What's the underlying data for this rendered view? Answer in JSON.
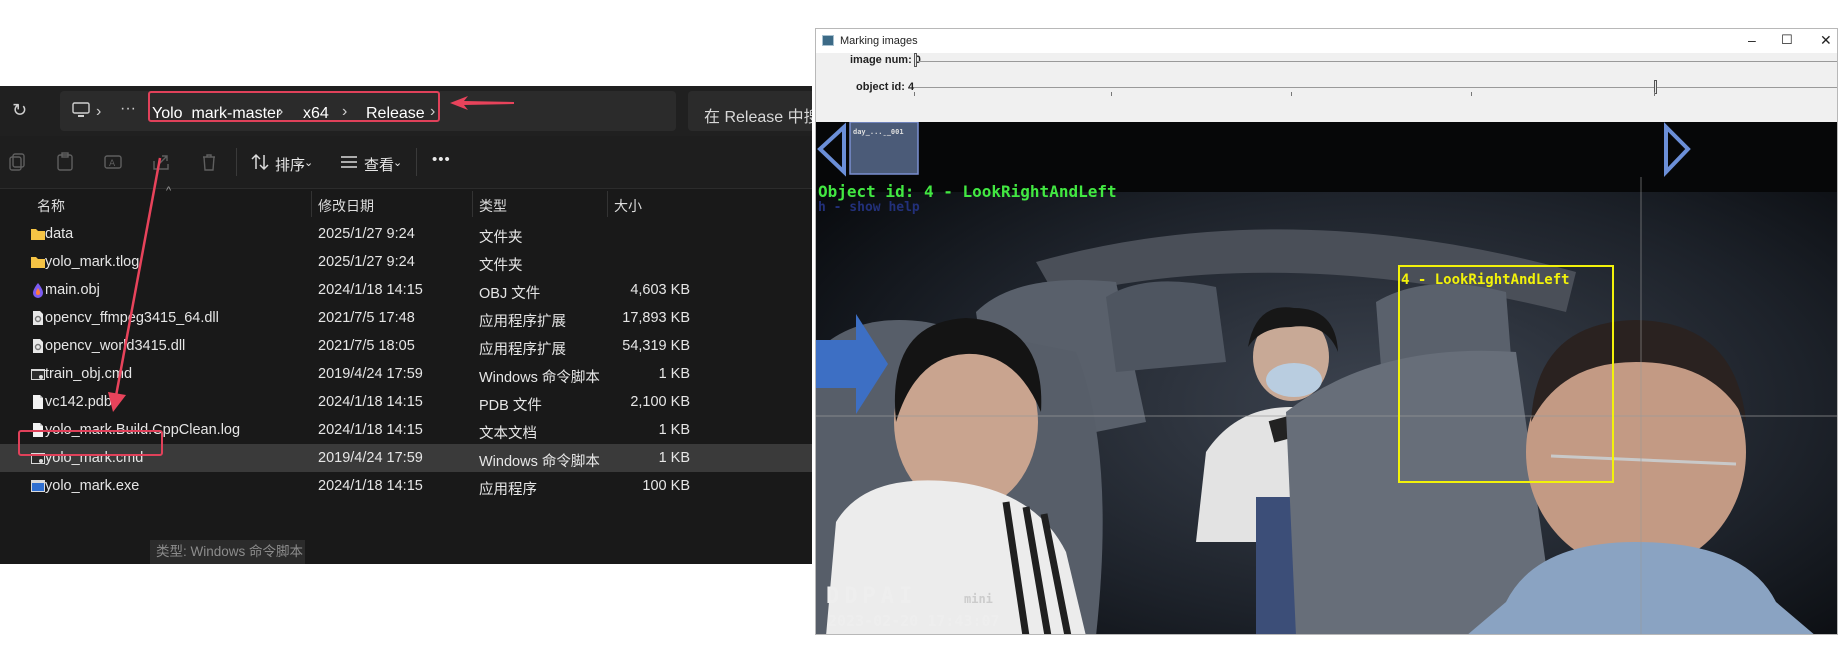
{
  "explorer": {
    "breadcrumb": [
      "Yolo_mark-master",
      "x64",
      "Release"
    ],
    "search_placeholder": "在 Release 中搜索",
    "toolbar": {
      "sort_label": "排序",
      "view_label": "查看",
      "more_label": "•••"
    },
    "columns": [
      "名称",
      "修改日期",
      "类型",
      "大小"
    ],
    "files": [
      {
        "name": "data",
        "date": "2025/1/27 9:24",
        "type": "文件夹",
        "size": "",
        "icon": "folder-icon"
      },
      {
        "name": "yolo_mark.tlog",
        "date": "2025/1/27 9:24",
        "type": "文件夹",
        "size": "",
        "icon": "folder-icon"
      },
      {
        "name": "main.obj",
        "date": "2024/1/18 14:15",
        "type": "OBJ 文件",
        "size": "4,603 KB",
        "icon": "obj-file-icon"
      },
      {
        "name": "opencv_ffmpeg3415_64.dll",
        "date": "2021/7/5 17:48",
        "type": "应用程序扩展",
        "size": "17,893 KB",
        "icon": "dll-file-icon"
      },
      {
        "name": "opencv_world3415.dll",
        "date": "2021/7/5 18:05",
        "type": "应用程序扩展",
        "size": "54,319 KB",
        "icon": "dll-file-icon"
      },
      {
        "name": "train_obj.cmd",
        "date": "2019/4/24 17:59",
        "type": "Windows 命令脚本",
        "size": "1 KB",
        "icon": "cmd-file-icon"
      },
      {
        "name": "vc142.pdb",
        "date": "2024/1/18 14:15",
        "type": "PDB 文件",
        "size": "2,100 KB",
        "icon": "file-icon"
      },
      {
        "name": "yolo_mark.Build.CppClean.log",
        "date": "2024/1/18 14:15",
        "type": "文本文档",
        "size": "1 KB",
        "icon": "file-icon"
      },
      {
        "name": "yolo_mark.cmd",
        "date": "2019/4/24 17:59",
        "type": "Windows 命令脚本",
        "size": "1 KB",
        "icon": "cmd-file-icon"
      },
      {
        "name": "yolo_mark.exe",
        "date": "2024/1/18 14:15",
        "type": "应用程序",
        "size": "100 KB",
        "icon": "exe-file-icon"
      }
    ],
    "tooltip": "类型: Windows 命令脚本"
  },
  "yolo": {
    "window_title": "Marking images",
    "trackbars": [
      {
        "label": "image num: 0",
        "value": 0
      },
      {
        "label": "object id: 4",
        "value": 4
      }
    ],
    "object_line": "Object id: 4   - LookRightAndLeft",
    "help_line": "h - show help",
    "bbox_label": "4 - LookRightAndLeft",
    "thumb_caption": "day_...̱_001",
    "camera_brand": "DDPAI",
    "camera_model": "mini",
    "timestamp": "2023-02-20  17:43:07",
    "colors": {
      "object_text": "#42e842",
      "bbox": "#f2f20a",
      "arrow_red": "#e8435b",
      "arrow_blue": "#3d6fc4"
    }
  }
}
